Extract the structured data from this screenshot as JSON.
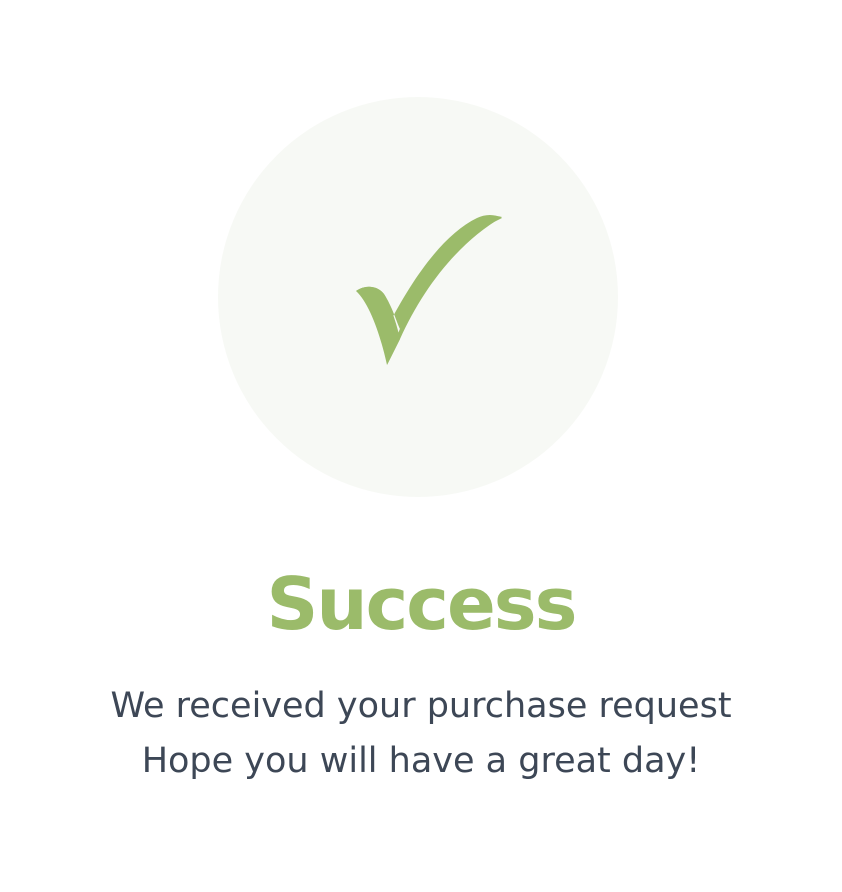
{
  "colors": {
    "accent": "#9bbb6a",
    "circle_background": "#f7f9f5",
    "text": "#3d4756",
    "background": "#ffffff"
  },
  "status": {
    "icon": "checkmark-icon",
    "title": "Success",
    "message_line1": "We received your purchase request",
    "message_line2": "Hope you will have a great day!"
  }
}
